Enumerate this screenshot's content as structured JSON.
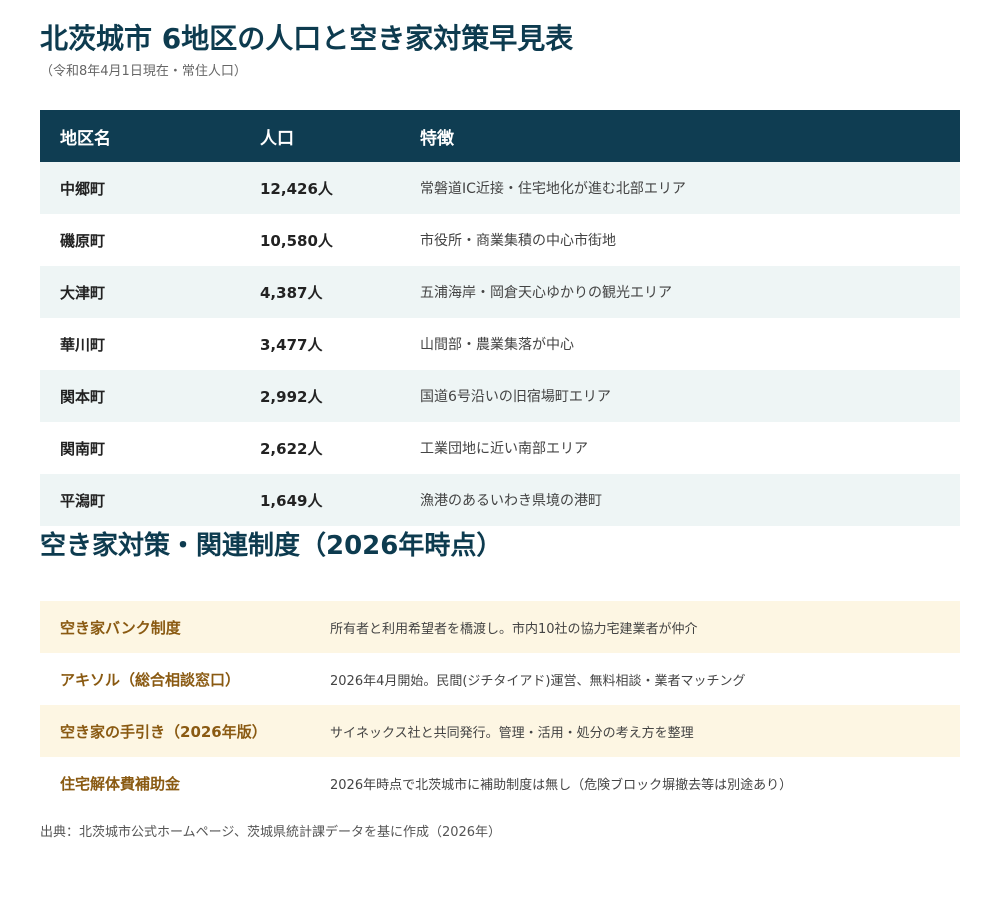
{
  "title": "北茨城市 6地区の人口と空き家対策早見表",
  "subtitle": "（令和8年4月1日現在・常住人口）",
  "population_table": {
    "headers": {
      "area": "地区名",
      "population": "人口",
      "feature": "特徴"
    },
    "rows": [
      {
        "area": "中郷町",
        "population": "12,426人",
        "feature": "常磐道IC近接・住宅地化が進む北部エリア"
      },
      {
        "area": "磯原町",
        "population": "10,580人",
        "feature": "市役所・商業集積の中心市街地"
      },
      {
        "area": "大津町",
        "population": "4,387人",
        "feature": "五浦海岸・岡倉天心ゆかりの観光エリア"
      },
      {
        "area": "華川町",
        "population": "3,477人",
        "feature": "山間部・農業集落が中心"
      },
      {
        "area": "関本町",
        "population": "2,992人",
        "feature": "国道6号沿いの旧宿場町エリア"
      },
      {
        "area": "関南町",
        "population": "2,622人",
        "feature": "工業団地に近い南部エリア"
      },
      {
        "area": "平潟町",
        "population": "1,649人",
        "feature": "漁港のあるいわき県境の港町"
      }
    ]
  },
  "measures_section": {
    "title": "空き家対策・関連制度（2026年時点）",
    "rows": [
      {
        "name": "空き家バンク制度",
        "description": "所有者と利用希望者を橋渡し。市内10社の協力宅建業者が仲介"
      },
      {
        "name": "アキソル（総合相談窓口）",
        "description": "2026年4月開始。民間(ジチタイアド)運営、無料相談・業者マッチング"
      },
      {
        "name": "空き家の手引き（2026年版）",
        "description": "サイネックス社と共同発行。管理・活用・処分の考え方を整理"
      },
      {
        "name": "住宅解体費補助金",
        "description": "2026年時点で北茨城市に補助制度は無し（危険ブロック塀撤去等は別途あり）"
      }
    ]
  },
  "source": "出典：北茨城市公式ホームページ、茨城県統計課データを基に作成（2026年）",
  "colors": {
    "heading": "#0d3b4f",
    "table_header_bg": "#0f3d52",
    "row_shade": "#eef5f5",
    "measure_shade": "#fdf6e3",
    "measure_name": "#8a5a12"
  }
}
